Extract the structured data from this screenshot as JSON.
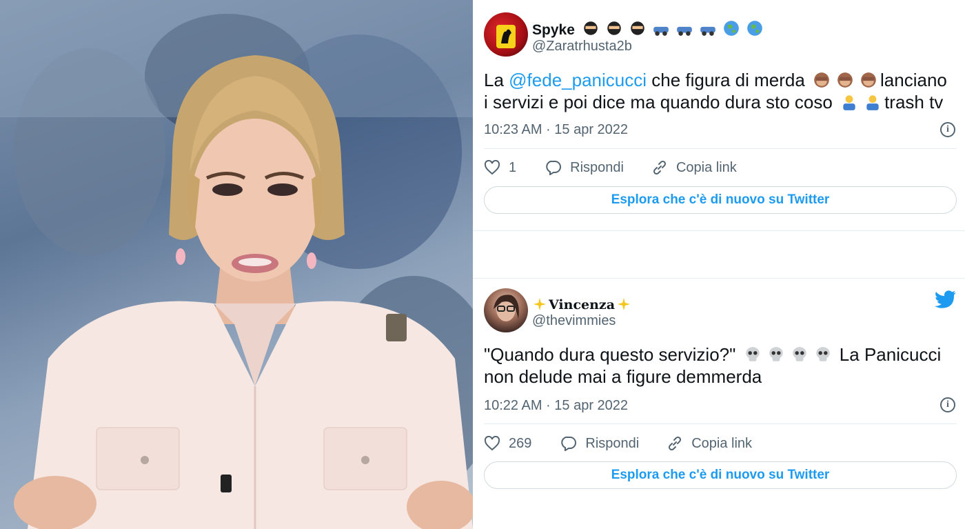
{
  "tweets": [
    {
      "display_name": "Spyke",
      "name_emojis": [
        "ninja-emoji",
        "ninja-emoji",
        "ninja-emoji",
        "car-emoji",
        "car-emoji",
        "car-emoji",
        "globe-emoji",
        "globe-emoji"
      ],
      "handle": "@Zaratrhusta2b",
      "text_before": "La ",
      "mention": "@fede_panicucci",
      "text_line1": "  che figura di merda ",
      "text_after_monkeys": "lanciano",
      "text_line2": "i servizi e poi dice ma quando dura sto coso ",
      "text_end": "trash tv",
      "timestamp": "10:23 AM · 15 apr 2022",
      "likes": "1",
      "reply_label": "Rispondi",
      "copy_label": "Copia link",
      "explore_label": "Esplora che c'è di nuovo su Twitter"
    },
    {
      "display_name": "Vincenza",
      "handle": "@thevimmies",
      "text_line1": "\"Quando dura questo servizio?\" ",
      "text_after_skulls": " La Panicucci",
      "text_line2": "non delude mai a figure demmerda",
      "timestamp": "10:22 AM · 15 apr 2022",
      "likes": "269",
      "reply_label": "Rispondi",
      "copy_label": "Copia link",
      "explore_label": "Esplora che c'è di nuovo su Twitter"
    }
  ],
  "colors": {
    "twitter_blue": "#1d9bf0",
    "muted": "#536471",
    "border": "#cfd9de"
  },
  "icons": [
    "heart-icon",
    "reply-icon",
    "link-icon",
    "info-icon",
    "twitter-bird-icon"
  ]
}
